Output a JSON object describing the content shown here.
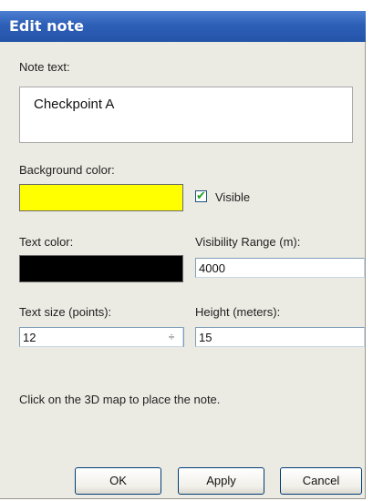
{
  "window": {
    "title": "Edit note"
  },
  "note": {
    "label": "Note text:",
    "value": "Checkpoint A"
  },
  "background": {
    "label": "Background color:",
    "color": "#ffff00",
    "visible_label": "Visible",
    "visible_checked": true
  },
  "text_color": {
    "label": "Text color:",
    "color": "#000000"
  },
  "visibility_range": {
    "label": "Visibility Range (m):",
    "value": "4000"
  },
  "text_size": {
    "label": "Text size (points):",
    "value": "12",
    "spinner_icon": "spinner-updown-icon"
  },
  "height": {
    "label": "Height (meters):",
    "value": "15"
  },
  "hint": "Click on the 3D map to place the note.",
  "buttons": {
    "ok": "OK",
    "apply": "Apply",
    "cancel": "Cancel"
  }
}
